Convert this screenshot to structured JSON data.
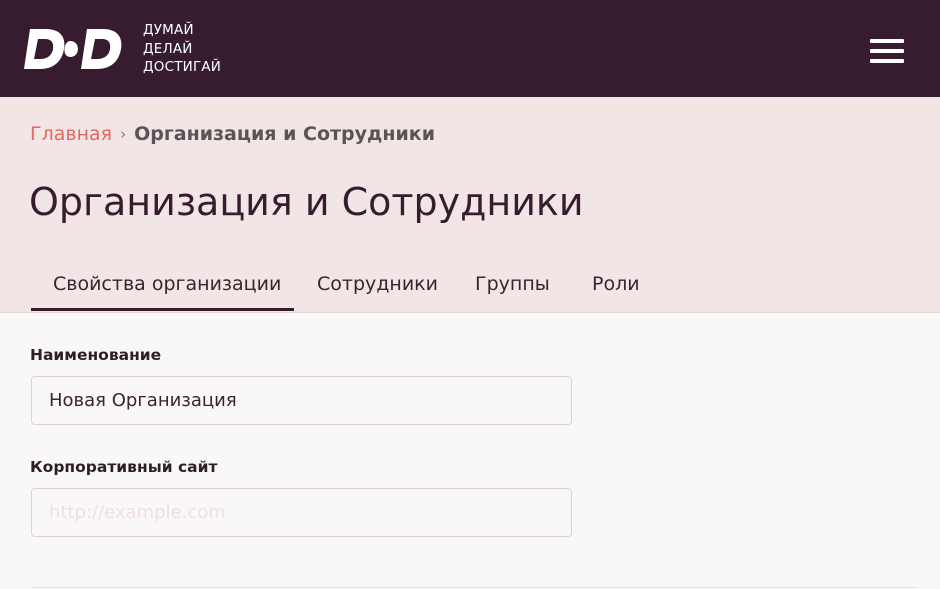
{
  "header": {
    "logo_alt": "DoD",
    "slogan": [
      "ДУМАЙ",
      "ДЕЛАЙ",
      "ДОСТИГАЙ"
    ],
    "menu_icon": "hamburger-menu-icon",
    "background_color": "#371c30"
  },
  "breadcrumb": {
    "home": "Главная",
    "separator": "›",
    "current": "Организация и Сотрудники"
  },
  "page_title": "Организация и Сотрудники",
  "tabs": [
    {
      "label": "Свойства организации",
      "active": true
    },
    {
      "label": "Сотрудники",
      "active": false
    },
    {
      "label": "Группы",
      "active": false
    },
    {
      "label": "Роли",
      "active": false
    }
  ],
  "form": {
    "name": {
      "label": "Наименование",
      "value": "Новая Организация",
      "placeholder": ""
    },
    "website": {
      "label": "Корпоративный сайт",
      "value": "",
      "placeholder": "http://example.com"
    }
  },
  "colors": {
    "accent_link": "#e3685f",
    "header_band": "#f1e6e5",
    "text_dark": "#371c30"
  }
}
